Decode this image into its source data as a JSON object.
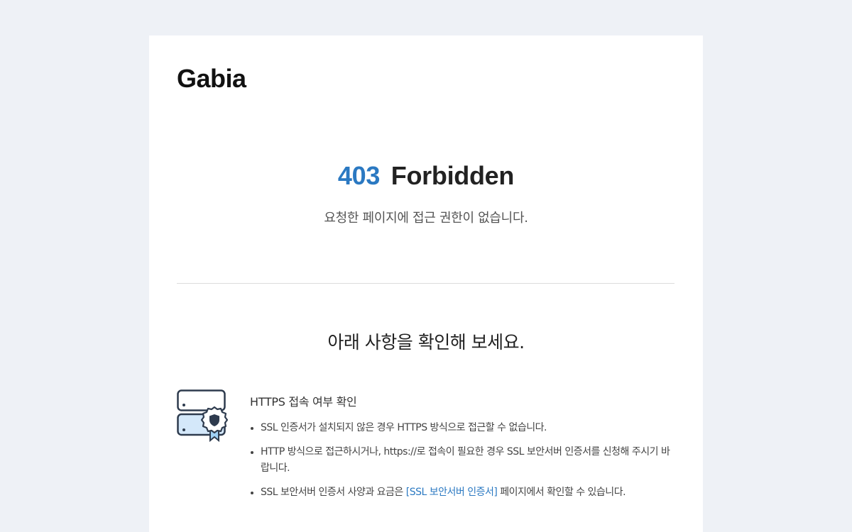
{
  "brand": {
    "name": "Gabia"
  },
  "error": {
    "code": "403",
    "title": "Forbidden",
    "message": "요청한 페이지에 접근 권한이 없습니다."
  },
  "check": {
    "title": "아래 사항을 확인해 보세요."
  },
  "section": {
    "icon": "ssl-server-certificate-icon",
    "heading": "HTTPS 접속 여부 확인",
    "bullets": [
      {
        "text": "SSL 인증서가 설치되지 않은 경우 HTTPS 방식으로 접근할 수 없습니다."
      },
      {
        "text": "HTTP 방식으로 접근하시거나, https://로 접속이 필요한 경우 SSL 보안서버 인증서를 신청해 주시기 바랍니다."
      },
      {
        "text_before": "SSL 보안서버 인증서 사양과 요금은 ",
        "link_text": "[SSL 보안서버 인증서]",
        "text_after": " 페이지에서 확인할 수 있습니다."
      }
    ]
  },
  "colors": {
    "accent": "#2b79c2",
    "background": "#eef1f6",
    "card": "#ffffff"
  }
}
